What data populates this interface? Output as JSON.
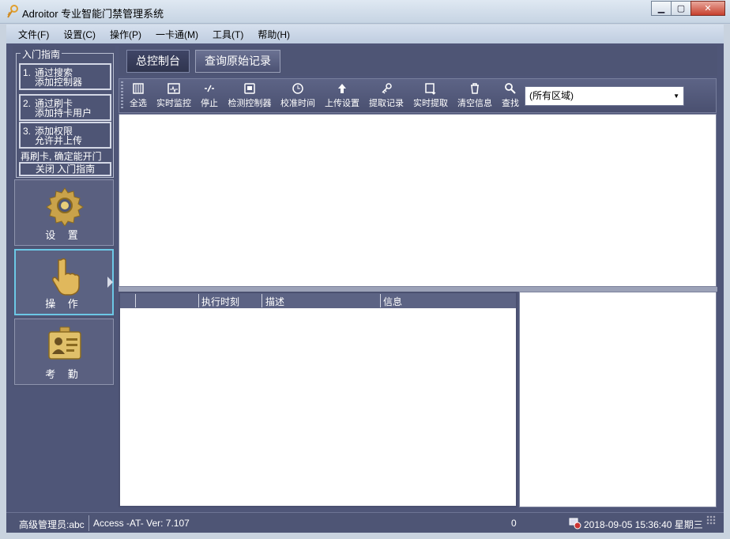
{
  "window": {
    "title": "Adroitor 专业智能门禁管理系统"
  },
  "menu": [
    "文件(F)",
    "设置(C)",
    "操作(P)",
    "一卡通(M)",
    "工具(T)",
    "帮助(H)"
  ],
  "guide": {
    "legend": "入门指南",
    "steps": [
      {
        "num": "1.",
        "line1": "通过搜索",
        "line2": "添加控制器"
      },
      {
        "num": "2.",
        "line1": "通过刷卡",
        "line2": "添加持卡用户"
      },
      {
        "num": "3.",
        "line1": "添加权限",
        "line2": "允许并上传"
      }
    ],
    "note": "再刷卡, 确定能开门",
    "close": "关闭 入门指南"
  },
  "nav": [
    {
      "label": "设 置",
      "icon": "gear-icon"
    },
    {
      "label": "操 作",
      "icon": "hand-pointer-icon",
      "active": true
    },
    {
      "label": "考 勤",
      "icon": "id-badge-icon"
    }
  ],
  "tabs": [
    "总控制台",
    "查询原始记录"
  ],
  "toolbar": [
    {
      "label": "全选",
      "icon": "select-all-icon"
    },
    {
      "label": "实时监控",
      "icon": "monitor-icon"
    },
    {
      "label": "停止",
      "icon": "stop-icon"
    },
    {
      "label": "检测控制器",
      "icon": "controller-check-icon"
    },
    {
      "label": "校准时间",
      "icon": "clock-icon"
    },
    {
      "label": "上传设置",
      "icon": "upload-arrow-icon"
    },
    {
      "label": "提取记录",
      "icon": "key-icon"
    },
    {
      "label": "实时提取",
      "icon": "floppy-download-icon"
    },
    {
      "label": "清空信息",
      "icon": "trash-icon"
    },
    {
      "label": "查找",
      "icon": "search-icon"
    }
  ],
  "area_select": {
    "value": "(所有区域)"
  },
  "log_table": {
    "columns": [
      "",
      "",
      "执行时刻",
      "描述",
      "信息"
    ]
  },
  "status": {
    "user": "高级管理员:abc",
    "version": "Access -AT- Ver: 7.107",
    "count": "0",
    "datetime": "2018-09-05 15:36:40 星期三"
  },
  "colors": {
    "accent": "#4e5575",
    "active_border": "#6cc8e6"
  }
}
